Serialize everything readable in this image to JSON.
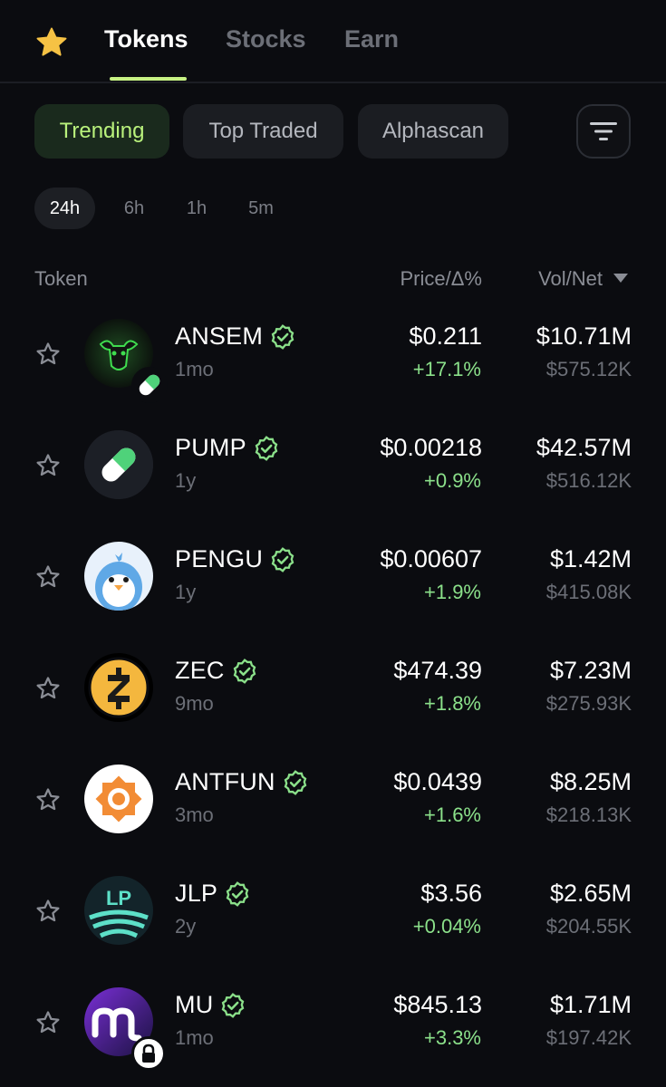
{
  "nav": {
    "tabs": [
      {
        "label": "Tokens",
        "active": true
      },
      {
        "label": "Stocks",
        "active": false
      },
      {
        "label": "Earn",
        "active": false
      }
    ]
  },
  "categories": [
    {
      "label": "Trending",
      "active": true
    },
    {
      "label": "Top Traded",
      "active": false
    },
    {
      "label": "Alphascan",
      "active": false
    }
  ],
  "timeframes": [
    {
      "label": "24h",
      "active": true
    },
    {
      "label": "6h",
      "active": false
    },
    {
      "label": "1h",
      "active": false
    },
    {
      "label": "5m",
      "active": false
    }
  ],
  "table": {
    "col_token": "Token",
    "col_price": "Price/Δ%",
    "col_vol": "Vol/Net",
    "rows": [
      {
        "symbol": "ANSEM",
        "age": "1mo",
        "price": "$0.211",
        "change": "+17.1%",
        "volume": "$10.71M",
        "net": "$575.12K",
        "icon": "bull-icon",
        "badge": "pill-icon"
      },
      {
        "symbol": "PUMP",
        "age": "1y",
        "price": "$0.00218",
        "change": "+0.9%",
        "volume": "$42.57M",
        "net": "$516.12K",
        "icon": "pill-icon"
      },
      {
        "symbol": "PENGU",
        "age": "1y",
        "price": "$0.00607",
        "change": "+1.9%",
        "volume": "$1.42M",
        "net": "$415.08K",
        "icon": "penguin-icon"
      },
      {
        "symbol": "ZEC",
        "age": "9mo",
        "price": "$474.39",
        "change": "+1.8%",
        "volume": "$7.23M",
        "net": "$275.93K",
        "icon": "zcash-icon"
      },
      {
        "symbol": "ANTFUN",
        "age": "3mo",
        "price": "$0.0439",
        "change": "+1.6%",
        "volume": "$8.25M",
        "net": "$218.13K",
        "icon": "antfun-icon"
      },
      {
        "symbol": "JLP",
        "age": "2y",
        "price": "$3.56",
        "change": "+0.04%",
        "volume": "$2.65M",
        "net": "$204.55K",
        "icon": "jlp-icon",
        "logo_text": "LP"
      },
      {
        "symbol": "MU",
        "age": "1mo",
        "price": "$845.13",
        "change": "+3.3%",
        "volume": "$1.71M",
        "net": "$197.42K",
        "icon": "micron-icon",
        "badge": "lock-icon"
      }
    ]
  },
  "colors": {
    "accent": "#b9f27c",
    "positive": "#8be08a",
    "star_gold": "#f6c244",
    "background": "#0b0c10"
  }
}
